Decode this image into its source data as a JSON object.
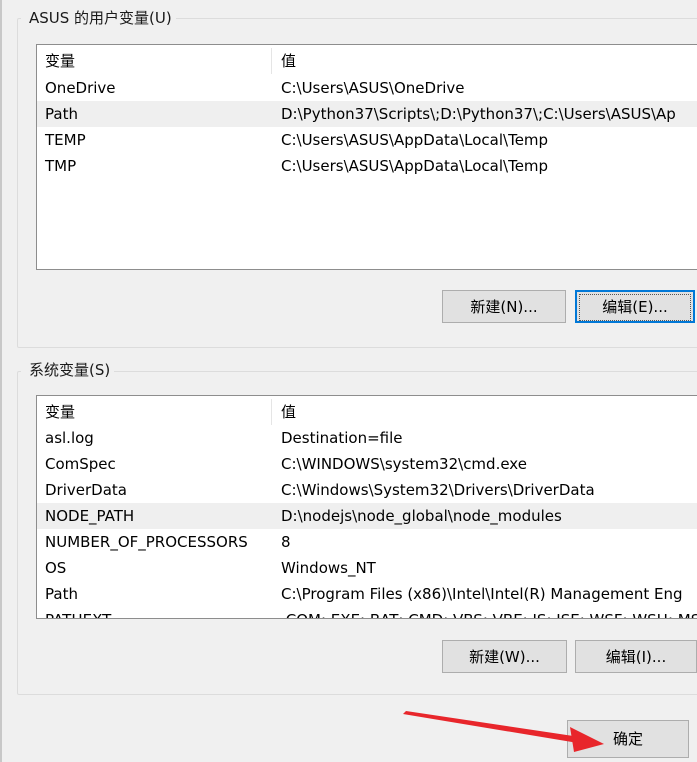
{
  "user_vars": {
    "group_title": "ASUS 的用户变量(U)",
    "col_variable": "变量",
    "col_value": "值",
    "rows": [
      {
        "name": "OneDrive",
        "value": "C:\\Users\\ASUS\\OneDrive"
      },
      {
        "name": "Path",
        "value": "D:\\Python37\\Scripts\\;D:\\Python37\\;C:\\Users\\ASUS\\Ap"
      },
      {
        "name": "TEMP",
        "value": "C:\\Users\\ASUS\\AppData\\Local\\Temp"
      },
      {
        "name": "TMP",
        "value": "C:\\Users\\ASUS\\AppData\\Local\\Temp"
      }
    ],
    "selected_row": "Path",
    "new_button": "新建(N)...",
    "edit_button": "编辑(E)..."
  },
  "system_vars": {
    "group_title": "系统变量(S)",
    "col_variable": "变量",
    "col_value": "值",
    "rows": [
      {
        "name": "asl.log",
        "value": "Destination=file"
      },
      {
        "name": "ComSpec",
        "value": "C:\\WINDOWS\\system32\\cmd.exe"
      },
      {
        "name": "DriverData",
        "value": "C:\\Windows\\System32\\Drivers\\DriverData"
      },
      {
        "name": "NODE_PATH",
        "value": "D:\\nodejs\\node_global\\node_modules"
      },
      {
        "name": "NUMBER_OF_PROCESSORS",
        "value": "8"
      },
      {
        "name": "OS",
        "value": "Windows_NT"
      },
      {
        "name": "Path",
        "value": "C:\\Program Files (x86)\\Intel\\Intel(R) Management Eng"
      },
      {
        "name": "PATHEXT",
        "value": ".COM;.EXE;.BAT;.CMD;.VBS;.VBE;.JS;.JSE;.WSF;.WSH;.MSC"
      }
    ],
    "selected_row": "NODE_PATH",
    "new_button": "新建(W)...",
    "edit_button": "编辑(I)..."
  },
  "ok_button": "确定",
  "annotation_color": "#e8262b"
}
